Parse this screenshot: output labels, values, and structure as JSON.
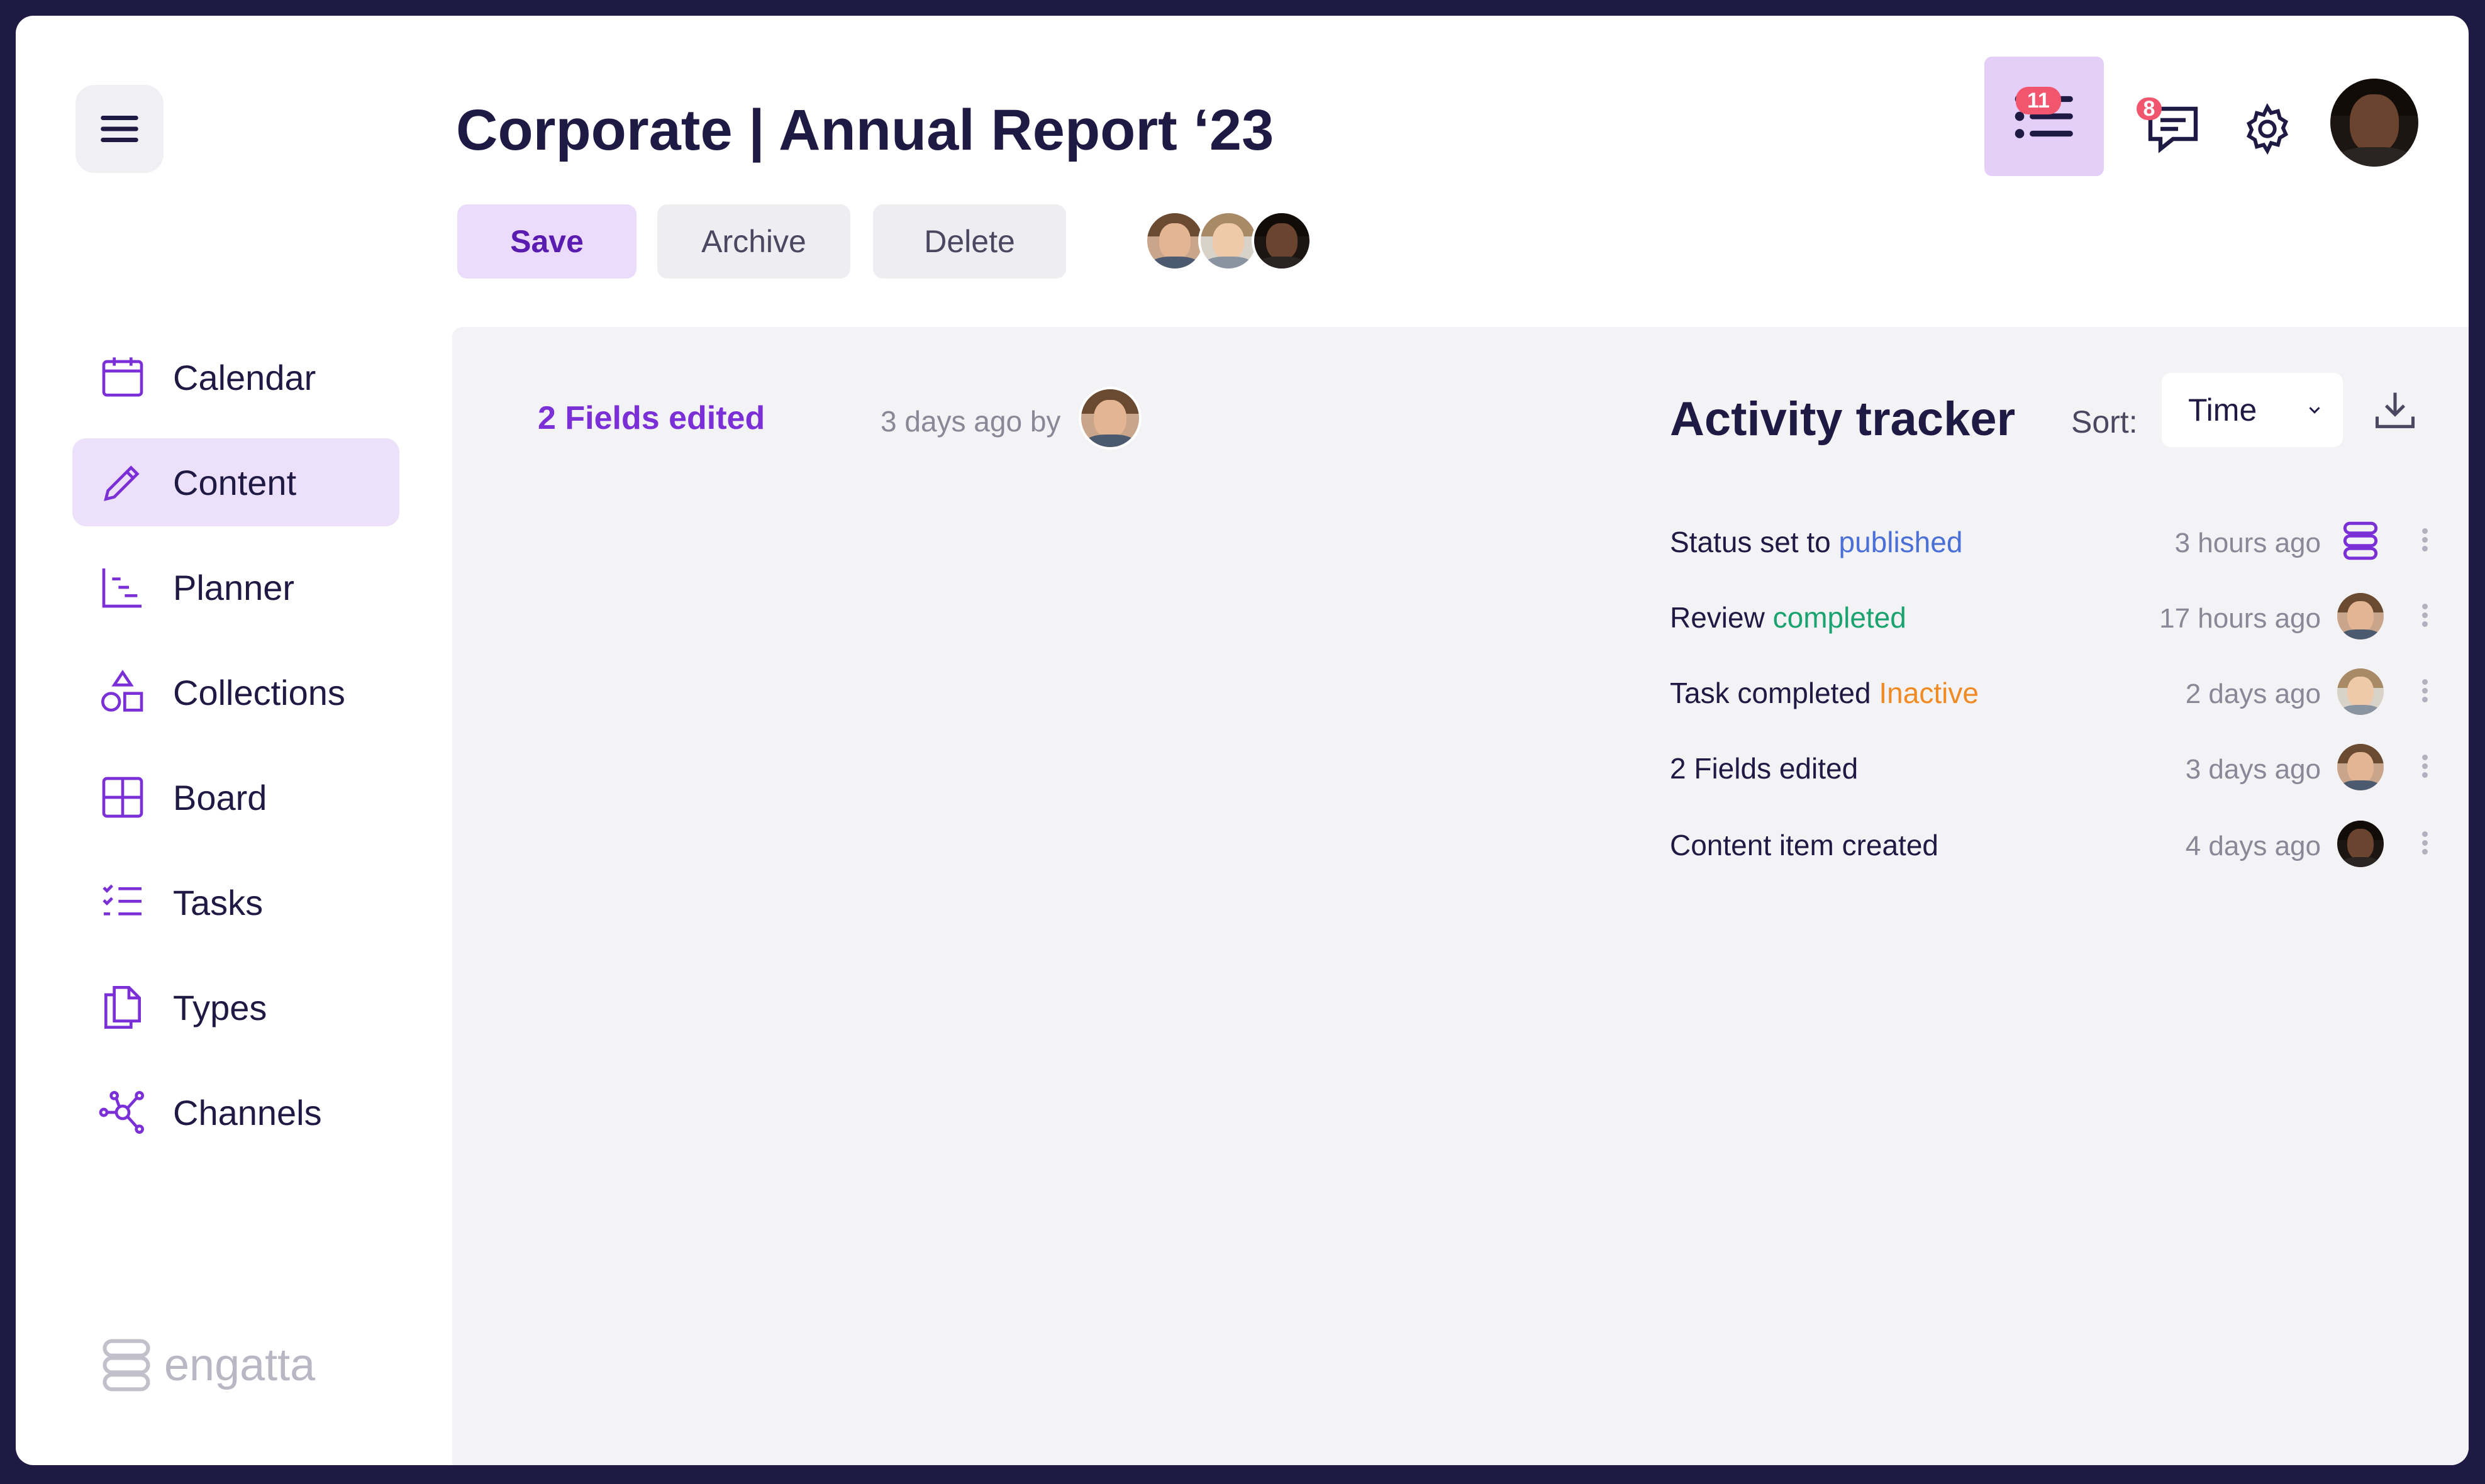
{
  "header": {
    "title": "Corporate | Annual Report ‘23",
    "buttons": {
      "save": "Save",
      "archive": "Archive",
      "delete": "Delete"
    },
    "badges": {
      "tasks": "11",
      "comments": "8"
    }
  },
  "sidebar": {
    "items": [
      {
        "label": "Calendar",
        "icon": "calendar-icon"
      },
      {
        "label": "Content",
        "icon": "pencil-icon",
        "active": true
      },
      {
        "label": "Planner",
        "icon": "planner-icon"
      },
      {
        "label": "Collections",
        "icon": "shapes-icon"
      },
      {
        "label": "Board",
        "icon": "board-icon"
      },
      {
        "label": "Tasks",
        "icon": "checklist-icon"
      },
      {
        "label": "Types",
        "icon": "documents-icon"
      },
      {
        "label": "Channels",
        "icon": "network-icon"
      }
    ],
    "logo_text": "engatta"
  },
  "main": {
    "edit_summary": "2 Fields edited",
    "edit_time": "3 days ago by"
  },
  "activity": {
    "title": "Activity tracker",
    "sort_label": "Sort:",
    "sort_value": "Time",
    "items": [
      {
        "text": "Status set to",
        "highlight": "published",
        "highlight_color": "#4a6fd6",
        "time": "3 hours ago",
        "icon": "engatta-logo-icon"
      },
      {
        "text": "Review",
        "highlight": "completed",
        "highlight_color": "#1aa36f",
        "time": "17 hours ago",
        "icon": "avatar"
      },
      {
        "text": "Task completed",
        "highlight": "Inactive",
        "highlight_color": "#f08a24",
        "time": "2 days ago",
        "icon": "avatar"
      },
      {
        "text": "2 Fields edited",
        "highlight": "",
        "time": "3 days ago",
        "icon": "avatar"
      },
      {
        "text": "Content item created",
        "highlight": "",
        "time": "4 days ago",
        "icon": "avatar"
      }
    ]
  },
  "colors": {
    "accent": "#7b2fd6",
    "accent_light": "#ece0fb",
    "navy": "#1f1a44",
    "badge": "#f2566e"
  }
}
